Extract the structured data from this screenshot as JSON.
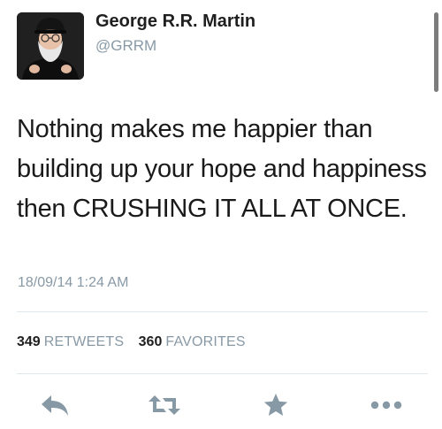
{
  "author": {
    "display_name": "George R.R. Martin",
    "handle": "@GRRM",
    "avatar_icon": "user-photo-avatar"
  },
  "tweet": {
    "text": "Nothing makes me happier than building up your hope and happiness then CRUSHING IT ALL AT ONCE.",
    "timestamp": "18/09/14 1:24 AM"
  },
  "stats": {
    "retweets_count": "349",
    "retweets_label": "RETWEETS",
    "favorites_count": "360",
    "favorites_label": "FAVORITES"
  },
  "actions": [
    {
      "name": "reply",
      "icon": "reply-icon"
    },
    {
      "name": "retweet",
      "icon": "retweet-icon"
    },
    {
      "name": "favorite",
      "icon": "star-icon"
    },
    {
      "name": "more",
      "icon": "more-dots-icon"
    }
  ],
  "colors": {
    "secondary_text": "#8899a6",
    "icon_gray": "#8899a6",
    "divider": "#e1e8ed",
    "primary_text": "#1a1a1a"
  }
}
